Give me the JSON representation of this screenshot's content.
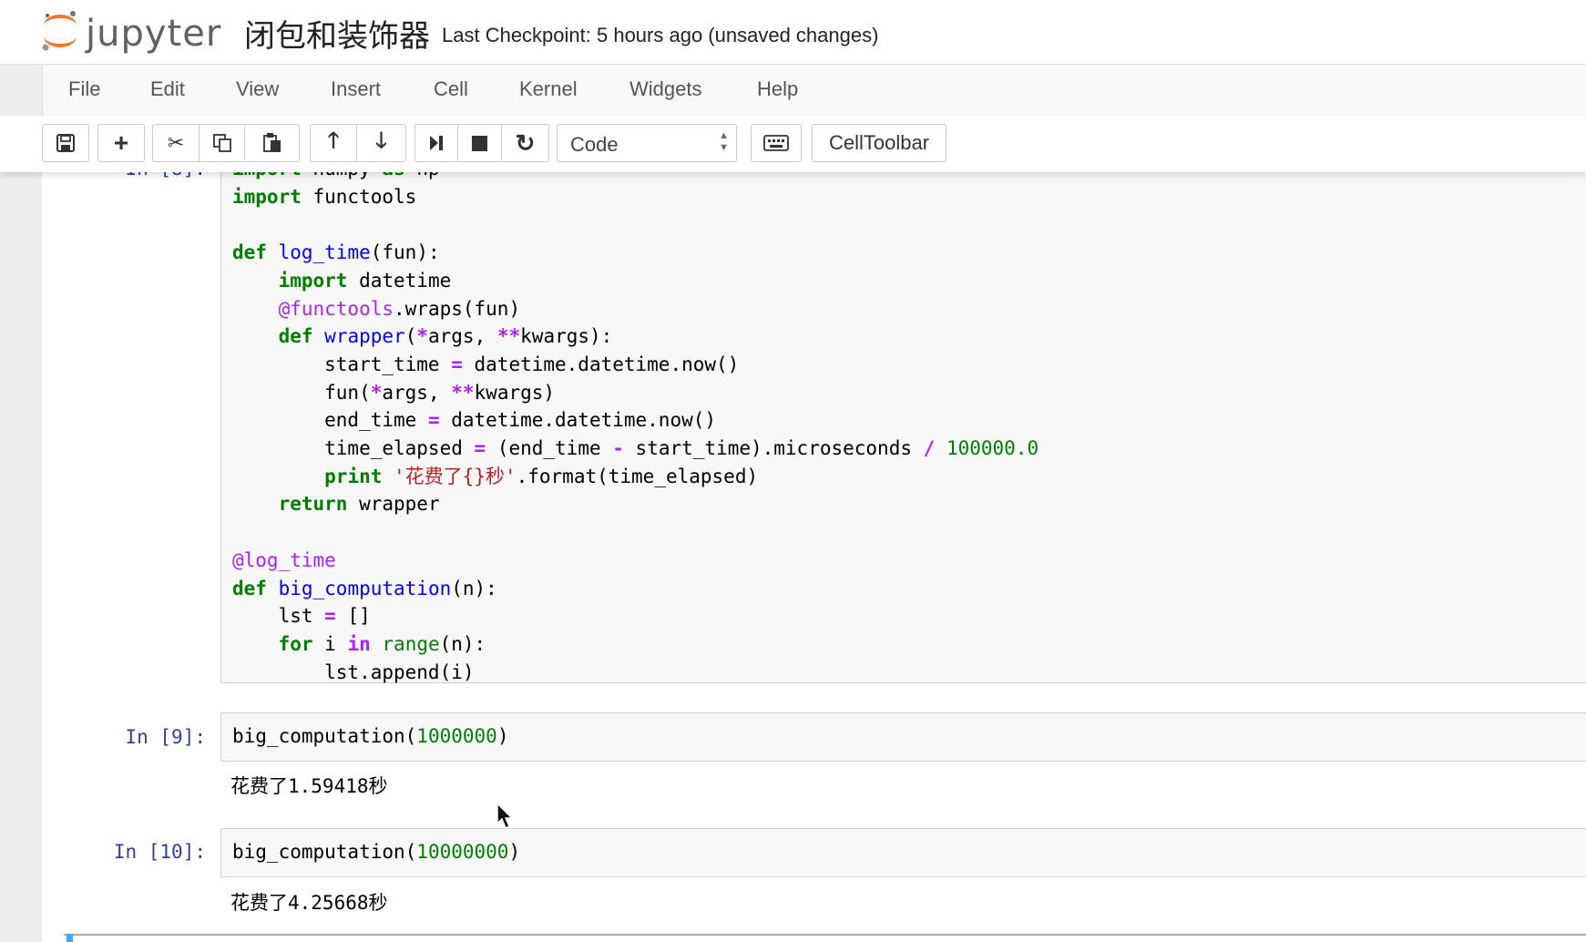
{
  "header": {
    "logo_text": "jupyter",
    "notebook_name": "闭包和装饰器",
    "checkpoint": "Last Checkpoint: 5 hours ago (unsaved changes)"
  },
  "menu": [
    "File",
    "Edit",
    "View",
    "Insert",
    "Cell",
    "Kernel",
    "Widgets",
    "Help"
  ],
  "toolbar": {
    "cell_type": "Code",
    "celltoolbar_label": "CellToolbar",
    "icons": [
      "save-icon",
      "plus-icon",
      "cut-icon",
      "copy-icon",
      "paste-icon",
      "arrow-up-icon",
      "arrow-down-icon",
      "run-icon",
      "stop-icon",
      "restart-icon",
      "keyboard-icon"
    ]
  },
  "cells": [
    {
      "prompt": "In [9]:",
      "code": "big_computation(1000000)",
      "output": "花费了1.59418秒"
    },
    {
      "prompt": "In [10]:",
      "code": "big_computation(10000000)",
      "output": "花费了4.25668秒"
    }
  ],
  "colors": {
    "keyword": "#008000",
    "function": "#0000ff",
    "decorator": "#aa22ff",
    "string": "#ba2121",
    "prompt": "#303f9f"
  }
}
